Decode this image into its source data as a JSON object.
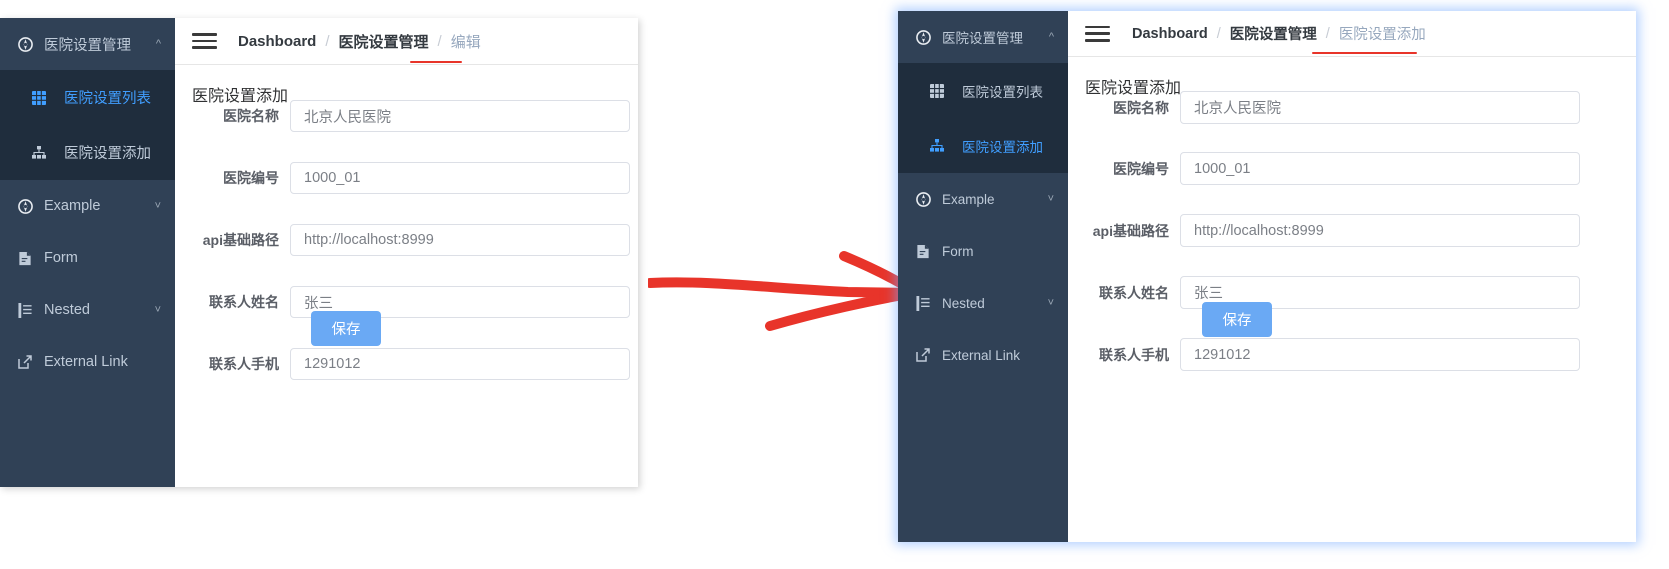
{
  "annotation": {
    "arrow_color": "#e8342a",
    "arrow_name": "red-hand-drawn-arrow"
  },
  "colors": {
    "sidebar_bg": "#304156",
    "sidebar_submenu_bg": "#1f2d3d",
    "sidebar_text": "#bfcbd9",
    "accent_blue": "#409eff",
    "button_blue": "#6aa9f4",
    "red_underline": "#e8342a",
    "panel_glow_blue": "#74a9ff"
  },
  "panels": [
    {
      "id": "before",
      "sidebar": {
        "group": {
          "label": "医院设置管理",
          "icon": "compass-icon",
          "arrow_icon": "chevron-up-icon"
        },
        "sub_items": [
          {
            "label": "医院设置列表",
            "icon": "grid-icon",
            "active": true
          },
          {
            "label": "医院设置添加",
            "icon": "sitemap-icon",
            "active": false
          }
        ],
        "items": [
          {
            "label": "Example",
            "icon": "compass-icon",
            "arrow_icon": "chevron-down-icon",
            "has_arrow": true
          },
          {
            "label": "Form",
            "icon": "form-icon",
            "has_arrow": false
          },
          {
            "label": "Nested",
            "icon": "list-icon",
            "arrow_icon": "chevron-down-icon",
            "has_arrow": true
          },
          {
            "label": "External Link",
            "icon": "external-link-icon",
            "has_arrow": false
          }
        ]
      },
      "navbar": {
        "hamburger_icon": "hamburger-icon",
        "breadcrumb": [
          {
            "label": "Dashboard",
            "muted": false
          },
          {
            "label": "医院设置管理",
            "muted": false
          },
          {
            "label": "编辑",
            "muted": true
          }
        ],
        "separator": "/"
      },
      "form": {
        "title": "医院设置添加",
        "fields": [
          {
            "label": "医院名称",
            "value": "北京人民医院"
          },
          {
            "label": "医院编号",
            "value": "1000_01"
          },
          {
            "label": "api基础路径",
            "value": "http://localhost:8999"
          },
          {
            "label": "联系人姓名",
            "value": "张三"
          },
          {
            "label": "联系人手机",
            "value": "1291012"
          }
        ],
        "save_label": "保存"
      }
    },
    {
      "id": "after",
      "sidebar": {
        "group": {
          "label": "医院设置管理",
          "icon": "compass-icon",
          "arrow_icon": "chevron-up-icon"
        },
        "sub_items": [
          {
            "label": "医院设置列表",
            "icon": "grid-icon",
            "active": false
          },
          {
            "label": "医院设置添加",
            "icon": "sitemap-icon",
            "active": true
          }
        ],
        "items": [
          {
            "label": "Example",
            "icon": "compass-icon",
            "arrow_icon": "chevron-down-icon",
            "has_arrow": true
          },
          {
            "label": "Form",
            "icon": "form-icon",
            "has_arrow": false
          },
          {
            "label": "Nested",
            "icon": "list-icon",
            "arrow_icon": "chevron-down-icon",
            "has_arrow": true
          },
          {
            "label": "External Link",
            "icon": "external-link-icon",
            "has_arrow": false
          }
        ]
      },
      "navbar": {
        "hamburger_icon": "hamburger-icon",
        "breadcrumb": [
          {
            "label": "Dashboard",
            "muted": false
          },
          {
            "label": "医院设置管理",
            "muted": false
          },
          {
            "label": "医院设置添加",
            "muted": true
          }
        ],
        "separator": "/"
      },
      "form": {
        "title": "医院设置添加",
        "fields": [
          {
            "label": "医院名称",
            "value": "北京人民医院"
          },
          {
            "label": "医院编号",
            "value": "1000_01"
          },
          {
            "label": "api基础路径",
            "value": "http://localhost:8999"
          },
          {
            "label": "联系人姓名",
            "value": "张三"
          },
          {
            "label": "联系人手机",
            "value": "1291012"
          }
        ],
        "save_label": "保存"
      }
    }
  ]
}
